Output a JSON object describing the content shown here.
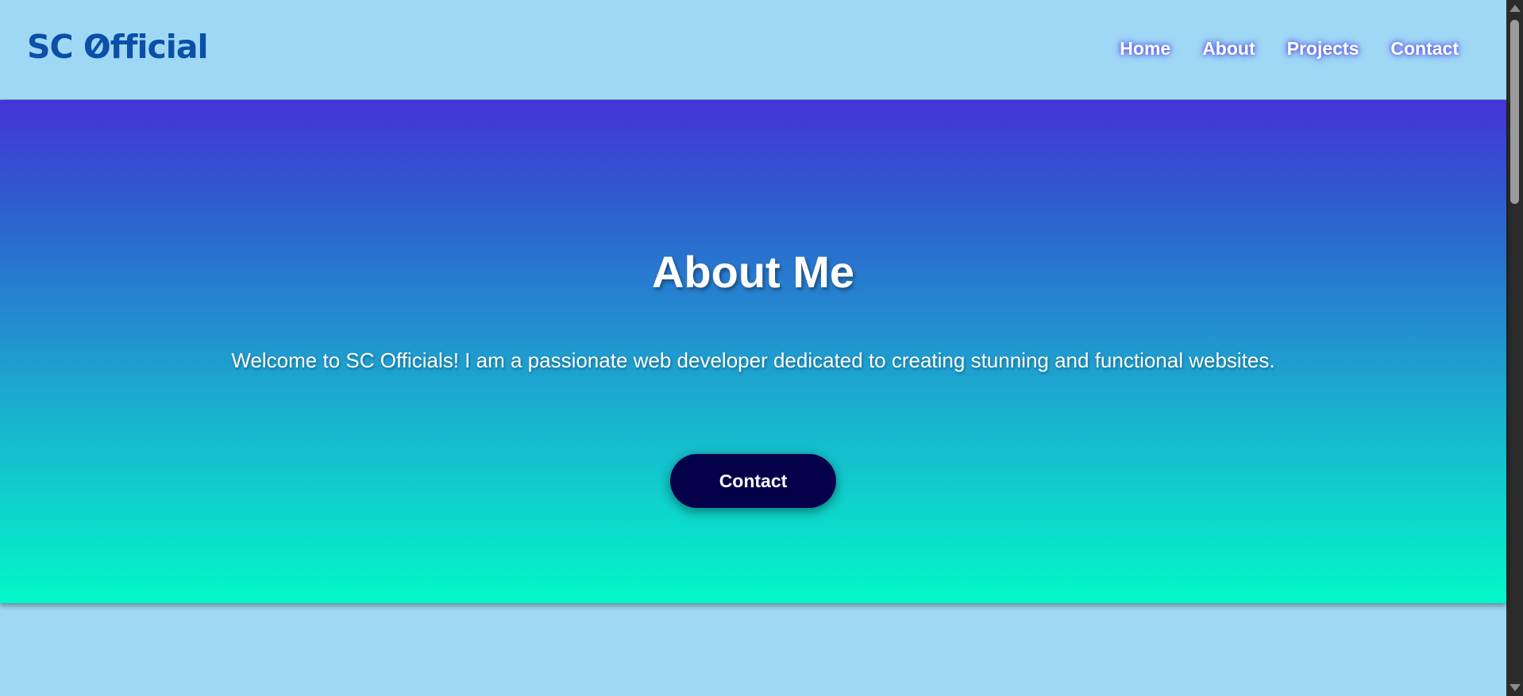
{
  "header": {
    "logo_prefix": "SC ",
    "logo_o": "O",
    "logo_suffix": "fficial",
    "logo_color": "#0b4fa8",
    "nav": [
      {
        "label": "Home"
      },
      {
        "label": "About"
      },
      {
        "label": "Projects"
      },
      {
        "label": "Contact"
      }
    ]
  },
  "hero": {
    "title": "About Me",
    "text": "Welcome to SC Officials! I am a passionate web developer dedicated to creating stunning and functional websites.",
    "button_label": "Contact",
    "gradient_top": "#4433d6",
    "gradient_bottom": "#02f8c8",
    "button_color": "#05004a"
  },
  "page": {
    "background": "#9fd8f5"
  }
}
